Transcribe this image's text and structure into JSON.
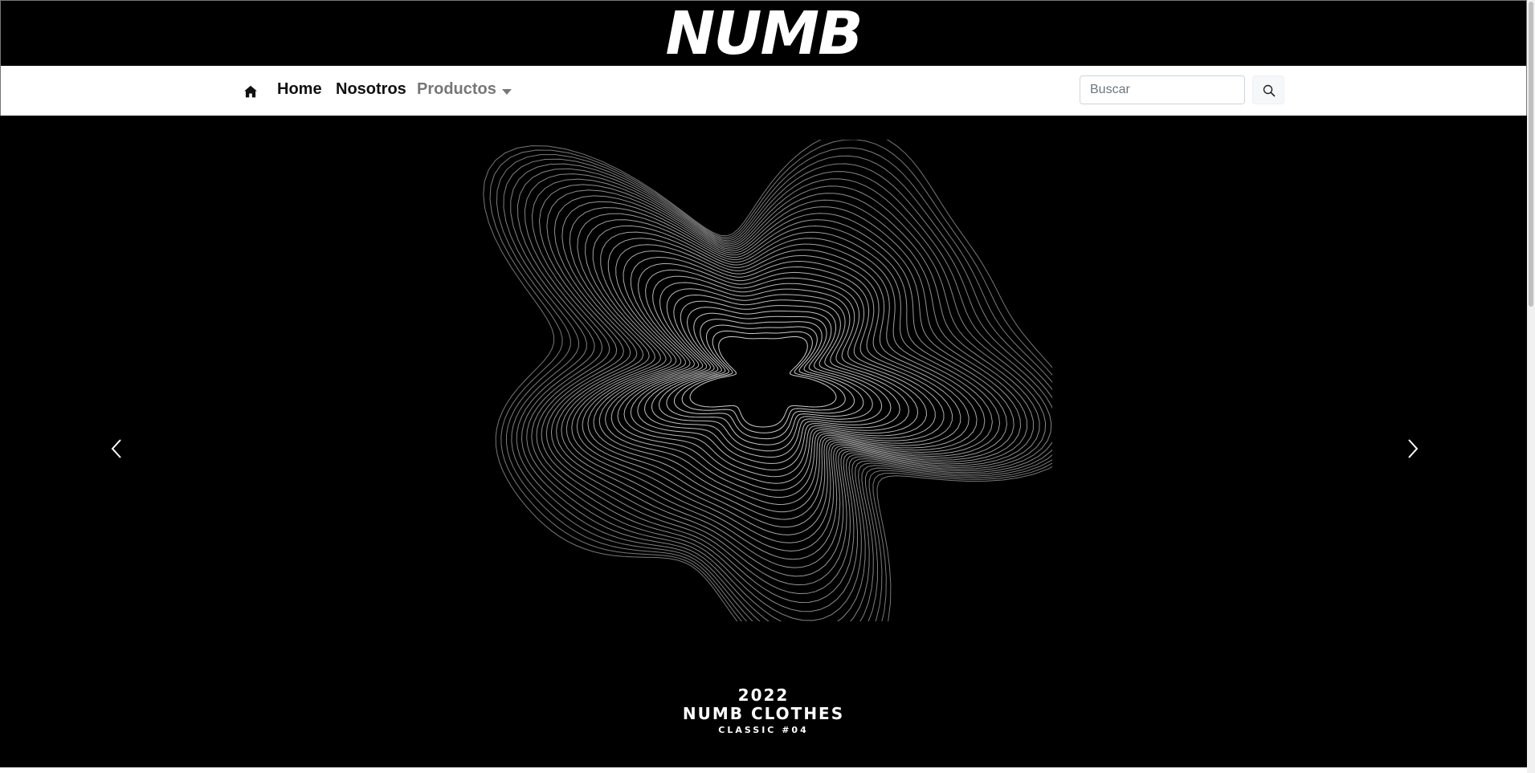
{
  "brand": {
    "logo_text": "NUMB"
  },
  "nav": {
    "home_icon": "home-icon",
    "links": [
      {
        "label": "Home"
      },
      {
        "label": "Nosotros"
      },
      {
        "label": "Productos"
      }
    ]
  },
  "search": {
    "placeholder": "Buscar",
    "value": "",
    "button_icon": "search-icon"
  },
  "hero": {
    "caption_year": "2022",
    "caption_title": "NUMB CLOTHES",
    "caption_subtitle": "CLASSIC #04",
    "prev_icon": "chevron-left-icon",
    "next_icon": "chevron-right-icon"
  },
  "colors": {
    "brand_bg": "#000000",
    "nav_bg": "#ffffff",
    "nav_text": "#111111",
    "nav_muted": "#777777"
  }
}
